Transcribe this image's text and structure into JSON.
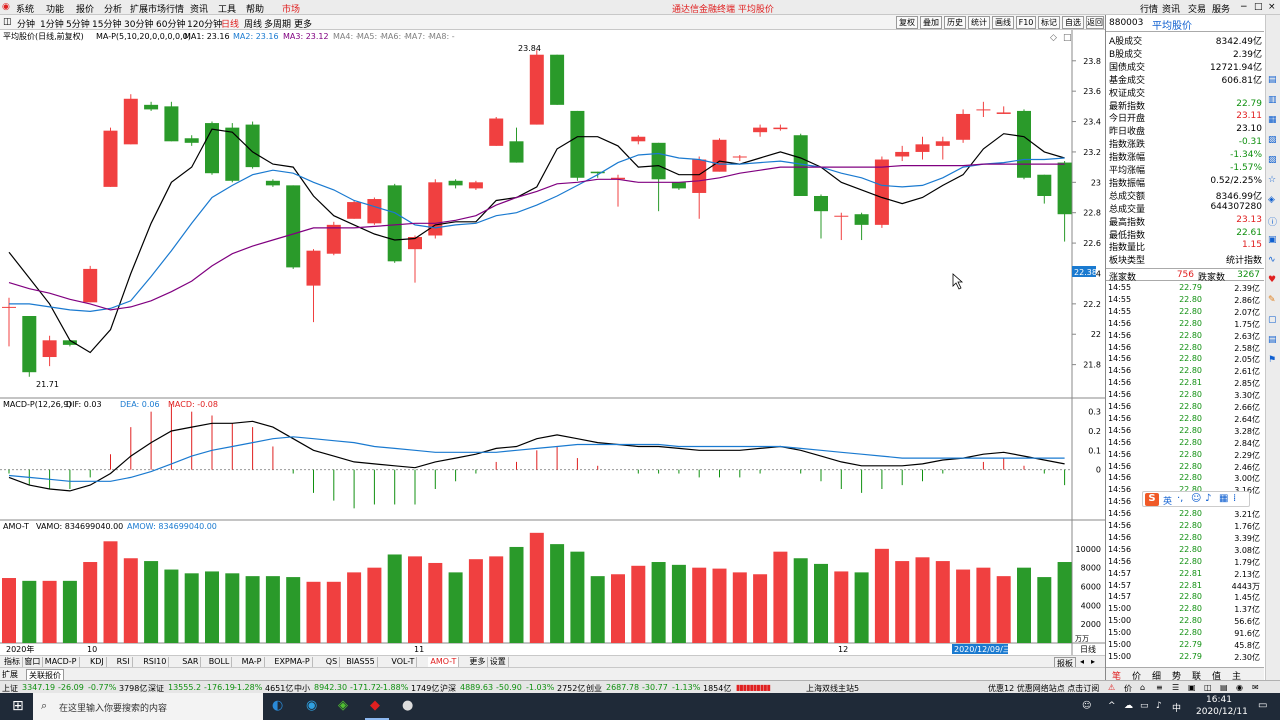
{
  "app": {
    "title": "通达信金融终端 平均股价",
    "title_color": "#e02020",
    "menu": [
      "系统",
      "功能",
      "报价",
      "分析",
      "扩展市场行情",
      "资讯",
      "工具",
      "帮助"
    ],
    "market_label": "市场",
    "right_menu": [
      "行情",
      "资讯",
      "交易",
      "服务"
    ]
  },
  "toolbar": {
    "periods": [
      "分钟",
      "1分钟",
      "5分钟",
      "15分钟",
      "30分钟",
      "60分钟",
      "120分钟",
      "日线",
      "周线",
      "多周期",
      "更多"
    ],
    "active_period": "日线",
    "buttons": [
      "复权",
      "叠加",
      "历史",
      "统计",
      "画线",
      "F10",
      "标记",
      "自选",
      "返回"
    ]
  },
  "panel_top": {
    "legend_title": "平均股价(日线,前复权)",
    "indicator": "MA-P(5,10,20,0,0,0,0,0)",
    "ma1": "MA1: 23.16",
    "ma2": "MA2: 23.16",
    "ma3": "MA3: 23.12",
    "ma_rest": [
      "MA4: -",
      "MA5: -",
      "MA6: -",
      "MA7: -",
      "MA8: -"
    ],
    "high_label": "23.84",
    "low_label": "21.71",
    "current_price_tag": "22.38"
  },
  "panel_macd": {
    "legend": "MACD-P(12,26,9)",
    "dif": "DIF: 0.03",
    "dea": "DEA: 0.06",
    "macd": "MACD: -0.08"
  },
  "panel_vol": {
    "legend": "AMO-T",
    "vamo": "VAMO: 834699040.00",
    "amow": "AMOW: 834699040.00",
    "unit": "万万"
  },
  "chart_data": [
    {
      "type": "candlestick",
      "title": "平均股价(日线,前复权)",
      "ylim": [
        21.6,
        23.95
      ],
      "yticks": [
        21.8,
        22.0,
        22.2,
        22.4,
        22.6,
        22.8,
        23.0,
        23.2,
        23.4,
        23.6,
        23.8
      ],
      "up_color": "#f04040",
      "down_color": "#2a9a2a",
      "candles": [
        [
          22.18,
          22.18,
          22.24,
          21.92
        ],
        [
          22.12,
          21.75,
          22.12,
          21.72
        ],
        [
          21.85,
          21.96,
          21.99,
          21.79
        ],
        [
          21.96,
          21.93,
          21.96,
          21.92
        ],
        [
          22.21,
          22.43,
          22.45,
          22.21
        ],
        [
          22.97,
          23.34,
          23.36,
          22.97
        ],
        [
          23.25,
          23.55,
          23.58,
          23.25
        ],
        [
          23.51,
          23.48,
          23.53,
          23.47
        ],
        [
          23.5,
          23.27,
          23.53,
          23.27
        ],
        [
          23.29,
          23.26,
          23.31,
          23.24
        ],
        [
          23.39,
          23.06,
          23.4,
          23.05
        ],
        [
          23.36,
          23.01,
          23.39,
          23.0
        ],
        [
          23.38,
          23.1,
          23.4,
          23.09
        ],
        [
          23.01,
          22.98,
          23.02,
          22.97
        ],
        [
          22.98,
          22.44,
          22.98,
          22.43
        ],
        [
          22.32,
          22.55,
          22.56,
          22.08
        ],
        [
          22.53,
          22.72,
          22.74,
          22.52
        ],
        [
          22.76,
          22.87,
          22.88,
          22.76
        ],
        [
          22.73,
          22.89,
          22.9,
          22.72
        ],
        [
          22.98,
          22.48,
          22.99,
          22.47
        ],
        [
          22.56,
          22.64,
          22.65,
          22.34
        ],
        [
          22.65,
          23.0,
          23.02,
          22.63
        ],
        [
          23.01,
          22.98,
          23.02,
          22.96
        ],
        [
          22.96,
          23.0,
          23.01,
          22.95
        ],
        [
          23.24,
          23.42,
          23.43,
          23.24
        ],
        [
          23.27,
          23.13,
          23.36,
          23.13
        ],
        [
          23.38,
          23.84,
          23.87,
          23.38
        ],
        [
          23.84,
          23.51,
          23.84,
          23.51
        ],
        [
          23.47,
          23.03,
          23.47,
          23.01
        ],
        [
          23.07,
          23.06,
          23.07,
          23.03
        ],
        [
          23.02,
          23.03,
          23.05,
          22.84
        ],
        [
          23.27,
          23.3,
          23.31,
          23.25
        ],
        [
          23.26,
          23.02,
          23.26,
          22.81
        ],
        [
          23.0,
          22.96,
          23.0,
          22.95
        ],
        [
          22.93,
          23.15,
          23.17,
          22.76
        ],
        [
          23.07,
          23.28,
          23.29,
          23.07
        ],
        [
          23.17,
          23.17,
          23.18,
          23.14
        ],
        [
          23.33,
          23.36,
          23.38,
          23.3
        ],
        [
          23.35,
          23.36,
          23.38,
          23.34
        ],
        [
          23.31,
          22.91,
          23.32,
          22.91
        ],
        [
          22.91,
          22.81,
          22.92,
          22.63
        ],
        [
          22.78,
          22.78,
          22.8,
          22.62
        ],
        [
          22.79,
          22.72,
          22.8,
          22.62
        ],
        [
          22.72,
          23.15,
          23.17,
          22.7
        ],
        [
          23.17,
          23.2,
          23.24,
          23.14
        ],
        [
          23.2,
          23.25,
          23.3,
          23.15
        ],
        [
          23.24,
          23.27,
          23.3,
          23.15
        ],
        [
          23.28,
          23.45,
          23.48,
          23.26
        ],
        [
          23.48,
          23.48,
          23.53,
          23.43
        ],
        [
          23.45,
          23.46,
          23.5,
          23.45
        ],
        [
          23.47,
          23.03,
          23.48,
          23.02
        ],
        [
          23.05,
          22.91,
          23.05,
          22.86
        ],
        [
          23.13,
          22.79,
          23.14,
          22.61
        ]
      ],
      "series": [
        {
          "name": "MA1",
          "color": "#000000",
          "values": [
            22.54,
            22.37,
            22.2,
            21.96,
            21.88,
            22.03,
            22.4,
            22.73,
            23.0,
            23.1,
            23.35,
            23.33,
            23.2,
            23.12,
            23.1,
            22.91,
            22.78,
            22.72,
            22.66,
            22.62,
            22.63,
            22.72,
            22.74,
            22.74,
            22.88,
            22.9,
            22.97,
            23.22,
            23.3,
            23.3,
            23.24,
            23.1,
            23.11,
            23.05,
            23.05,
            23.14,
            23.12,
            23.16,
            23.2,
            23.16,
            23.1,
            23.0,
            22.95,
            22.9,
            22.86,
            22.9,
            22.98,
            23.05,
            23.22,
            23.32,
            23.3,
            23.2,
            23.16
          ]
        },
        {
          "name": "MA2",
          "color": "#1a7ad0",
          "values": [
            22.2,
            22.2,
            22.18,
            22.16,
            22.15,
            22.17,
            22.22,
            22.38,
            22.55,
            22.73,
            22.9,
            22.98,
            23.05,
            23.08,
            23.06,
            23.0,
            22.95,
            22.88,
            22.84,
            22.8,
            22.72,
            22.7,
            22.72,
            22.73,
            22.78,
            22.8,
            22.85,
            22.91,
            22.98,
            23.05,
            23.13,
            23.18,
            23.19,
            23.16,
            23.15,
            23.12,
            23.12,
            23.13,
            23.14,
            23.12,
            23.1,
            23.06,
            23.03,
            22.98,
            22.97,
            22.98,
            23.03,
            23.1,
            23.12,
            23.13,
            23.15,
            23.15,
            23.16
          ]
        },
        {
          "name": "MA3",
          "color": "#800080",
          "values": [
            22.34,
            22.3,
            22.27,
            22.23,
            22.2,
            22.16,
            22.18,
            22.22,
            22.28,
            22.35,
            22.45,
            22.53,
            22.58,
            22.62,
            22.66,
            22.7,
            22.7,
            22.7,
            22.71,
            22.72,
            22.73,
            22.73,
            22.75,
            22.78,
            22.85,
            22.9,
            22.94,
            22.99,
            23.0,
            23.02,
            23.02,
            23.0,
            23.0,
            23.0,
            23.01,
            23.03,
            23.06,
            23.08,
            23.1,
            23.1,
            23.1,
            23.1,
            23.1,
            23.1,
            23.11,
            23.11,
            23.11,
            23.11,
            23.12,
            23.12,
            23.12,
            23.12,
            23.12
          ]
        }
      ]
    },
    {
      "type": "bar",
      "title": "MACD-P(12,26,9)",
      "ylim": [
        -0.25,
        0.35
      ],
      "yticks": [
        0.0,
        0.1,
        0.2,
        0.3
      ],
      "series": [
        {
          "name": "DIF",
          "color": "#000000",
          "values": [
            -0.04,
            -0.08,
            -0.1,
            -0.11,
            -0.08,
            -0.02,
            0.07,
            0.14,
            0.2,
            0.22,
            0.24,
            0.24,
            0.25,
            0.22,
            0.16,
            0.1,
            0.07,
            0.04,
            0.03,
            0.02,
            0.01,
            0.04,
            0.06,
            0.08,
            0.11,
            0.12,
            0.16,
            0.18,
            0.16,
            0.14,
            0.13,
            0.12,
            0.12,
            0.11,
            0.1,
            0.1,
            0.1,
            0.11,
            0.12,
            0.1,
            0.07,
            0.04,
            0.02,
            0.02,
            0.02,
            0.03,
            0.05,
            0.06,
            0.08,
            0.09,
            0.07,
            0.05,
            0.03
          ]
        },
        {
          "name": "DEA",
          "color": "#1a7ad0",
          "values": [
            -0.03,
            -0.04,
            -0.05,
            -0.06,
            -0.06,
            -0.06,
            -0.04,
            -0.01,
            0.03,
            0.07,
            0.1,
            0.12,
            0.14,
            0.16,
            0.17,
            0.16,
            0.15,
            0.14,
            0.12,
            0.11,
            0.1,
            0.09,
            0.09,
            0.09,
            0.09,
            0.1,
            0.11,
            0.12,
            0.13,
            0.13,
            0.13,
            0.13,
            0.13,
            0.12,
            0.12,
            0.12,
            0.12,
            0.12,
            0.12,
            0.11,
            0.1,
            0.09,
            0.08,
            0.07,
            0.06,
            0.06,
            0.06,
            0.06,
            0.06,
            0.06,
            0.06,
            0.06,
            0.06
          ]
        },
        {
          "name": "MACD",
          "color": "#e02020",
          "values": [
            -0.02,
            -0.08,
            -0.1,
            -0.1,
            -0.04,
            0.08,
            0.22,
            0.3,
            0.34,
            0.3,
            0.28,
            0.24,
            0.22,
            0.12,
            -0.02,
            -0.12,
            -0.16,
            -0.2,
            -0.18,
            -0.18,
            -0.18,
            -0.1,
            -0.06,
            -0.02,
            0.04,
            0.04,
            0.1,
            0.12,
            0.06,
            0.02,
            0.0,
            -0.02,
            -0.02,
            -0.02,
            -0.04,
            -0.04,
            -0.04,
            -0.02,
            0.0,
            -0.02,
            -0.06,
            -0.1,
            -0.12,
            -0.1,
            -0.08,
            -0.06,
            -0.02,
            0.0,
            0.04,
            0.06,
            0.02,
            -0.02,
            -0.08
          ]
        }
      ]
    },
    {
      "type": "bar",
      "title": "AMO-T",
      "ylim": [
        0,
        12000
      ],
      "yticks": [
        2000,
        4000,
        6000,
        8000,
        10000
      ],
      "values": [
        6900,
        6600,
        6600,
        6600,
        8600,
        10800,
        9000,
        8700,
        7800,
        7400,
        7600,
        7400,
        7100,
        7100,
        7000,
        6500,
        6500,
        7500,
        8000,
        9400,
        9200,
        8500,
        7500,
        8900,
        9200,
        10200,
        11700,
        10500,
        9700,
        7100,
        7300,
        8200,
        8600,
        8300,
        8000,
        7900,
        7500,
        7300,
        9700,
        9000,
        8400,
        7600,
        7500,
        10000,
        8700,
        9100,
        8700,
        7800,
        8000,
        7100,
        8000,
        7000,
        8600
      ]
    }
  ],
  "xaxis_labels": [
    "2020年",
    "10",
    "11",
    "12",
    "2020/12/09/三"
  ],
  "quote_panel": {
    "code": "880003",
    "name": "平均股价",
    "rows": [
      {
        "label": "A股成交",
        "value": "8342.49亿",
        "color": "#000000"
      },
      {
        "label": "B股成交",
        "value": "2.39亿",
        "color": "#000000"
      },
      {
        "label": "国债成交",
        "value": "12721.94亿",
        "color": "#000000"
      },
      {
        "label": "基金成交",
        "value": "606.81亿",
        "color": "#000000"
      },
      {
        "label": "权证成交",
        "value": "",
        "color": "#000000"
      },
      {
        "label": "最新指数",
        "value": "22.79",
        "color": "#109010"
      },
      {
        "label": "今日开盘",
        "value": "23.11",
        "color": "#e02020"
      },
      {
        "label": "昨日收盘",
        "value": "23.10",
        "color": "#000000"
      },
      {
        "label": "指数涨跌",
        "value": "-0.31",
        "color": "#109010"
      },
      {
        "label": "指数涨幅",
        "value": "-1.34%",
        "color": "#109010"
      },
      {
        "label": "平均涨幅",
        "value": "-1.57%",
        "color": "#109010"
      },
      {
        "label": "指数振幅",
        "value": "0.52/2.25%",
        "color": "#000000"
      },
      {
        "label": "总成交额",
        "value": "8346.99亿",
        "color": "#000000"
      },
      {
        "label": "总成交量",
        "value": "644307280",
        "color": "#000000"
      },
      {
        "label": "最高指数",
        "value": "23.13",
        "color": "#e02020"
      },
      {
        "label": "最低指数",
        "value": "22.61",
        "color": "#109010"
      },
      {
        "label": "指数量比",
        "value": "1.15",
        "color": "#e02020"
      },
      {
        "label": "板块类型",
        "value": "统计指数",
        "color": "#000000"
      }
    ],
    "adv_label": "涨家数",
    "adv_value": "756",
    "dec_label": "跌家数",
    "dec_value": "3267"
  },
  "ticks": [
    [
      "14:55",
      "22.79",
      "2.39亿"
    ],
    [
      "14:55",
      "22.80",
      "2.86亿"
    ],
    [
      "14:55",
      "22.80",
      "2.07亿"
    ],
    [
      "14:56",
      "22.80",
      "1.75亿"
    ],
    [
      "14:56",
      "22.80",
      "2.63亿"
    ],
    [
      "14:56",
      "22.80",
      "2.58亿"
    ],
    [
      "14:56",
      "22.80",
      "2.05亿"
    ],
    [
      "14:56",
      "22.80",
      "2.61亿"
    ],
    [
      "14:56",
      "22.81",
      "2.85亿"
    ],
    [
      "14:56",
      "22.80",
      "3.30亿"
    ],
    [
      "14:56",
      "22.80",
      "2.66亿"
    ],
    [
      "14:56",
      "22.80",
      "2.64亿"
    ],
    [
      "14:56",
      "22.80",
      "3.28亿"
    ],
    [
      "14:56",
      "22.80",
      "2.84亿"
    ],
    [
      "14:56",
      "22.80",
      "2.29亿"
    ],
    [
      "14:56",
      "22.80",
      "2.46亿"
    ],
    [
      "14:56",
      "22.80",
      "3.00亿"
    ],
    [
      "14:56",
      "22.80",
      "3.16亿"
    ],
    [
      "14:56",
      "",
      ""
    ],
    [
      "14:56",
      "22.80",
      "3.21亿"
    ],
    [
      "14:56",
      "22.80",
      "1.76亿"
    ],
    [
      "14:56",
      "22.80",
      "3.39亿"
    ],
    [
      "14:56",
      "22.80",
      "3.08亿"
    ],
    [
      "14:56",
      "22.80",
      "1.79亿"
    ],
    [
      "14:57",
      "22.81",
      "2.13亿"
    ],
    [
      "14:57",
      "22.81",
      "4443万"
    ],
    [
      "14:57",
      "22.80",
      "1.45亿"
    ],
    [
      "15:00",
      "22.80",
      "1.37亿"
    ],
    [
      "15:00",
      "22.80",
      "56.6亿"
    ],
    [
      "15:00",
      "22.80",
      "91.6亿"
    ],
    [
      "15:00",
      "22.79",
      "45.8亿"
    ],
    [
      "15:00",
      "22.79",
      "2.30亿"
    ]
  ],
  "indicator_tabs": [
    "指标",
    "窗口",
    "MACD-P",
    "KDJ",
    "RSI",
    "RSI10",
    "SAR",
    "BOLL",
    "MA-P",
    "EXPMA-P",
    "QS",
    "BIAS55",
    "VOL-T",
    "AMO-T",
    "更多",
    "设置"
  ],
  "active_indicator_tab": "AMO-T",
  "ext_tabs": [
    "扩展",
    "关联报价"
  ],
  "right_bottom_tabs": [
    "报板",
    "日线"
  ],
  "quote_tabs": [
    "笔",
    "价",
    "细",
    "势",
    "联",
    "值",
    "主"
  ],
  "status": {
    "items": [
      {
        "name": "上证",
        "value": "3347.19",
        "chg": "-26.09",
        "pct": "-0.77%",
        "amt": "3798亿"
      },
      {
        "name": "深证",
        "value": "13555.2",
        "chg": "-176.19",
        "pct": "-1.28%",
        "amt": "4651亿"
      },
      {
        "name": "中小",
        "value": "8942.30",
        "chg": "-171.72",
        "pct": "-1.88%",
        "amt": "1749亿"
      },
      {
        "name": "沪深",
        "value": "4889.63",
        "chg": "-50.90",
        "pct": "-1.03%",
        "amt": "2752亿"
      },
      {
        "name": "创业",
        "value": "2687.78",
        "chg": "-30.77",
        "pct": "-1.13%",
        "amt": "1854亿"
      }
    ],
    "server": "上海双线主站5",
    "ad": "优惠12 优惠网络站点 点击订阅"
  },
  "taskbar": {
    "search_placeholder": "在这里输入你要搜索的内容",
    "time": "16:41",
    "date": "2020/12/11"
  },
  "ime": {
    "label": "英"
  }
}
